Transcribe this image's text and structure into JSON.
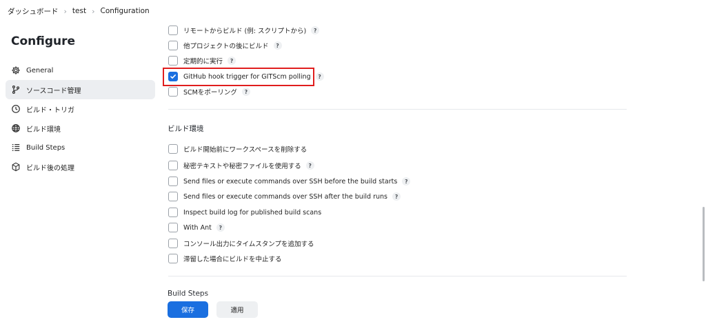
{
  "breadcrumb": {
    "items": [
      "ダッシュボード",
      "test",
      "Configuration"
    ]
  },
  "sidebar": {
    "title": "Configure",
    "items": [
      {
        "label": "General",
        "icon": "gear-icon"
      },
      {
        "label": "ソースコード管理",
        "icon": "branch-icon",
        "active": true
      },
      {
        "label": "ビルド・トリガ",
        "icon": "clock-icon"
      },
      {
        "label": "ビルド環境",
        "icon": "globe-icon"
      },
      {
        "label": "Build Steps",
        "icon": "list-icon"
      },
      {
        "label": "ビルド後の処理",
        "icon": "cube-icon"
      }
    ]
  },
  "triggers": {
    "options": [
      {
        "label": "リモートからビルド (例: スクリプトから)",
        "checked": false,
        "help": true
      },
      {
        "label": "他プロジェクトの後にビルド",
        "checked": false,
        "help": true
      },
      {
        "label": "定期的に実行",
        "checked": false,
        "help": true
      },
      {
        "label": "GitHub hook trigger for GITScm polling",
        "checked": true,
        "help": true
      },
      {
        "label": "SCMをポーリング",
        "checked": false,
        "help": true
      }
    ]
  },
  "build_env": {
    "title": "ビルド環境",
    "options": [
      {
        "label": "ビルド開始前にワークスペースを削除する",
        "checked": false,
        "help": false
      },
      {
        "label": "秘密テキストや秘密ファイルを使用する",
        "checked": false,
        "help": true
      },
      {
        "label": "Send files or execute commands over SSH before the build starts",
        "checked": false,
        "help": true
      },
      {
        "label": "Send files or execute commands over SSH after the build runs",
        "checked": false,
        "help": true
      },
      {
        "label": "Inspect build log for published build scans",
        "checked": false,
        "help": false
      },
      {
        "label": "With Ant",
        "checked": false,
        "help": true
      },
      {
        "label": "コンソール出力にタイムスタンプを追加する",
        "checked": false,
        "help": false
      },
      {
        "label": "滞留した場合にビルドを中止する",
        "checked": false,
        "help": false
      }
    ]
  },
  "build_steps": {
    "title": "Build Steps"
  },
  "help_symbol": "?",
  "footer": {
    "save_label": "保存",
    "apply_label": "適用"
  },
  "colors": {
    "accent": "#1a6fe0",
    "highlight": "#e01d1d"
  }
}
